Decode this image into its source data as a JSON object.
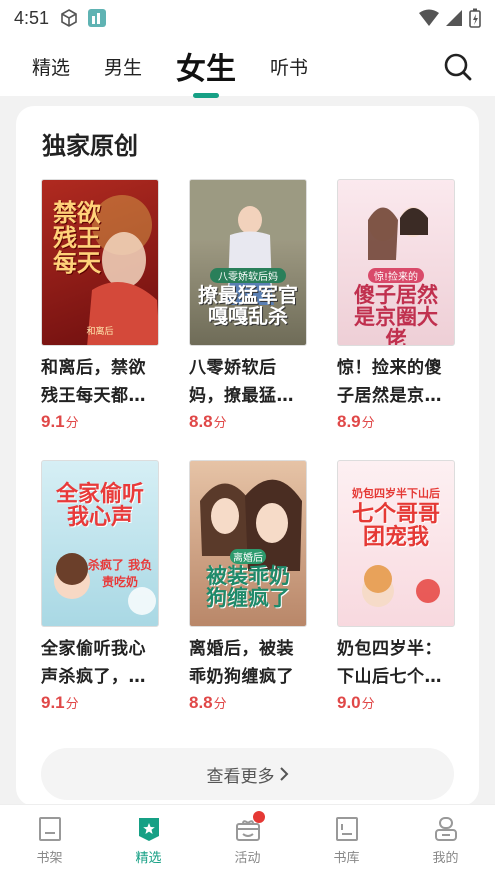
{
  "status": {
    "time": "4:51"
  },
  "tabs": [
    {
      "label": "精选"
    },
    {
      "label": "男生"
    },
    {
      "label": "女生"
    },
    {
      "label": "听书"
    }
  ],
  "section": {
    "title": "独家原创"
  },
  "books": [
    {
      "title": "和离后，禁欲残王每天都…",
      "score": "9.1",
      "unit": "分",
      "cover_text": "禁欲残王每天",
      "cover_sub": "和离后",
      "cover_bg": "#8b1a1a"
    },
    {
      "title": "八零娇软后妈，撩最猛…",
      "score": "8.8",
      "unit": "分",
      "cover_text": "撩最猛军官嘎嘎乱杀",
      "cover_sub": "八零娇软后妈",
      "cover_bg": "#8a8a70"
    },
    {
      "title": "惊！捡来的傻子居然是京…",
      "score": "8.9",
      "unit": "分",
      "cover_text": "傻子居然是京圈大佬",
      "cover_sub": "惊!捡来的",
      "cover_bg": "#f3d6dc"
    },
    {
      "title": "全家偷听我心声杀疯了，…",
      "score": "9.1",
      "unit": "分",
      "cover_text": "全家偷听我心声",
      "cover_sub": "杀疯了 我负责吃奶",
      "cover_bg": "#bfe3ec"
    },
    {
      "title": "离婚后，被装乖奶狗缠疯了",
      "score": "8.8",
      "unit": "分",
      "cover_text": "被装乖奶狗缠疯了",
      "cover_sub": "离婚后",
      "cover_bg": "#d9a98a"
    },
    {
      "title": "奶包四岁半：下山后七个…",
      "score": "9.0",
      "unit": "分",
      "cover_text": "七个哥哥团宠我",
      "cover_sub": "奶包四岁半下山后",
      "cover_bg": "#fbe6ea"
    }
  ],
  "more": {
    "label": "查看更多"
  },
  "nav": [
    {
      "label": "书架"
    },
    {
      "label": "精选"
    },
    {
      "label": "活动"
    },
    {
      "label": "书库"
    },
    {
      "label": "我的"
    }
  ],
  "colors": {
    "accent": "#16a085",
    "score": "#e04848",
    "badge": "#e53935"
  }
}
